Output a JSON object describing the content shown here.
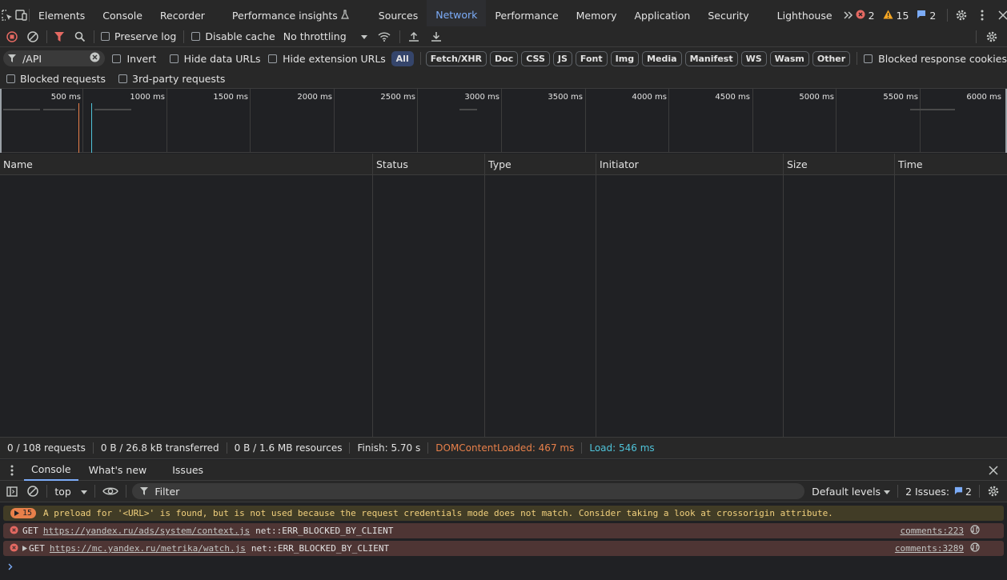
{
  "topbar": {
    "tabs": [
      "Elements",
      "Console",
      "Recorder",
      "Performance insights",
      "Sources",
      "Network",
      "Performance",
      "Memory",
      "Application",
      "Security",
      "Lighthouse"
    ],
    "active_tab": "Network",
    "errors_count": "2",
    "warnings_count": "15",
    "issues_count": "2"
  },
  "nettool": {
    "preserve_log": "Preserve log",
    "disable_cache": "Disable cache",
    "throttling": "No throttling"
  },
  "filter": {
    "value": "/API",
    "invert": "Invert",
    "hide_data_urls": "Hide data URLs",
    "hide_ext_urls": "Hide extension URLs",
    "chips": [
      "All",
      "Fetch/XHR",
      "Doc",
      "CSS",
      "JS",
      "Font",
      "Img",
      "Media",
      "Manifest",
      "WS",
      "Wasm",
      "Other"
    ],
    "blocked_cookies": "Blocked response cookies",
    "blocked_requests": "Blocked requests",
    "third_party": "3rd-party requests"
  },
  "timeline": {
    "ticks": [
      "500 ms",
      "1000 ms",
      "1500 ms",
      "2000 ms",
      "2500 ms",
      "3000 ms",
      "3500 ms",
      "4000 ms",
      "4500 ms",
      "5000 ms",
      "5500 ms",
      "6000 ms"
    ],
    "dcl_color": "#e8804a",
    "load_color": "#4fc3d9"
  },
  "table": {
    "columns": [
      "Name",
      "Status",
      "Type",
      "Initiator",
      "Size",
      "Time"
    ]
  },
  "summary": {
    "requests": "0 / 108 requests",
    "transferred": "0 B / 26.8 kB transferred",
    "resources": "0 B / 1.6 MB resources",
    "finish": "Finish: 5.70 s",
    "dcl": "DOMContentLoaded: 467 ms",
    "load": "Load: 546 ms"
  },
  "drawer": {
    "tabs": [
      "Console",
      "What's new",
      "Issues"
    ],
    "active_tab": "Console",
    "context": "top",
    "filter_placeholder": "Filter",
    "levels": "Default levels",
    "issues_label": "2 Issues:",
    "issues_count": "2"
  },
  "console": {
    "warning": {
      "count": "15",
      "text": "A preload for '<URL>' is found, but is not used because the request credentials mode does not match. Consider taking a look at crossorigin attribute."
    },
    "errors": [
      {
        "method": "GET",
        "url": "https://yandex.ru/ads/system/context.js",
        "status": "net::ERR_BLOCKED_BY_CLIENT",
        "source": "comments:223"
      },
      {
        "method": "GET",
        "url": "https://mc.yandex.ru/metrika/watch.js",
        "status": "net::ERR_BLOCKED_BY_CLIENT",
        "source": "comments:3289"
      }
    ]
  }
}
